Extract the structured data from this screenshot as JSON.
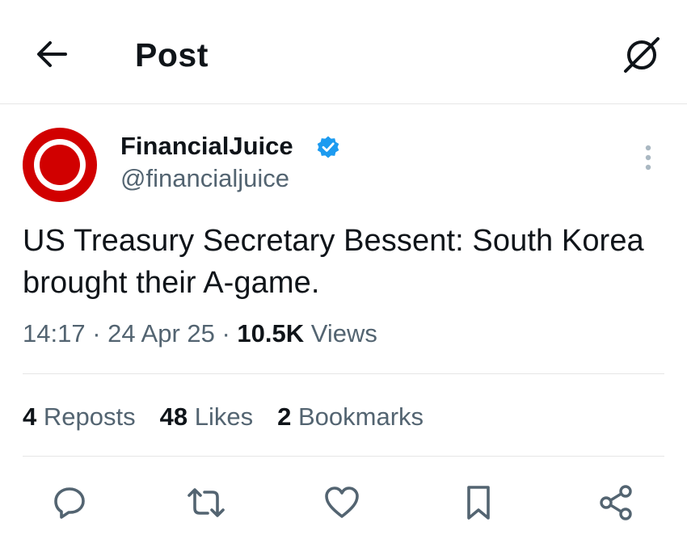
{
  "header": {
    "title": "Post",
    "back_icon": "arrow-left-icon",
    "grok_icon": "grok-icon"
  },
  "author": {
    "display_name": "FinancialJuice",
    "handle": "@financialjuice",
    "verified": true,
    "avatar_color": "#d10000"
  },
  "post": {
    "text": "US Treasury Secretary Bessent: South Korea brought their A-game.",
    "time": "14:17",
    "date": "24 Apr 25",
    "views_count": "10.5K",
    "views_label": "Views"
  },
  "stats": [
    {
      "count": "4",
      "label": "Reposts"
    },
    {
      "count": "48",
      "label": "Likes"
    },
    {
      "count": "2",
      "label": "Bookmarks"
    }
  ],
  "actions": [
    "reply-icon",
    "repost-icon",
    "like-icon",
    "bookmark-icon",
    "share-icon"
  ],
  "colors": {
    "text": "#0f1419",
    "secondary": "#536471",
    "verified": "#1d9bf0",
    "divider": "#e6e6e6"
  }
}
